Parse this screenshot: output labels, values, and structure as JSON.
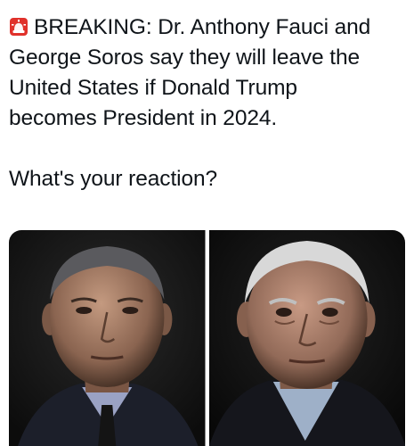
{
  "tweet": {
    "emoji_icon": "police-car-light-icon",
    "lines": [
      "BREAKING: Dr. Anthony Fauci and",
      "George Soros say they will leave the",
      "United States if Donald Trump",
      "becomes President in 2024."
    ],
    "question": "What's your reaction?"
  },
  "media": {
    "photos": [
      {
        "subject": "portrait-photo-left",
        "background_color": "#1b1b1b"
      },
      {
        "subject": "portrait-photo-right",
        "background_color": "#141414"
      }
    ]
  },
  "colors": {
    "text": "#0f1419",
    "background": "#ffffff",
    "emoji_red": "#e0312b"
  }
}
